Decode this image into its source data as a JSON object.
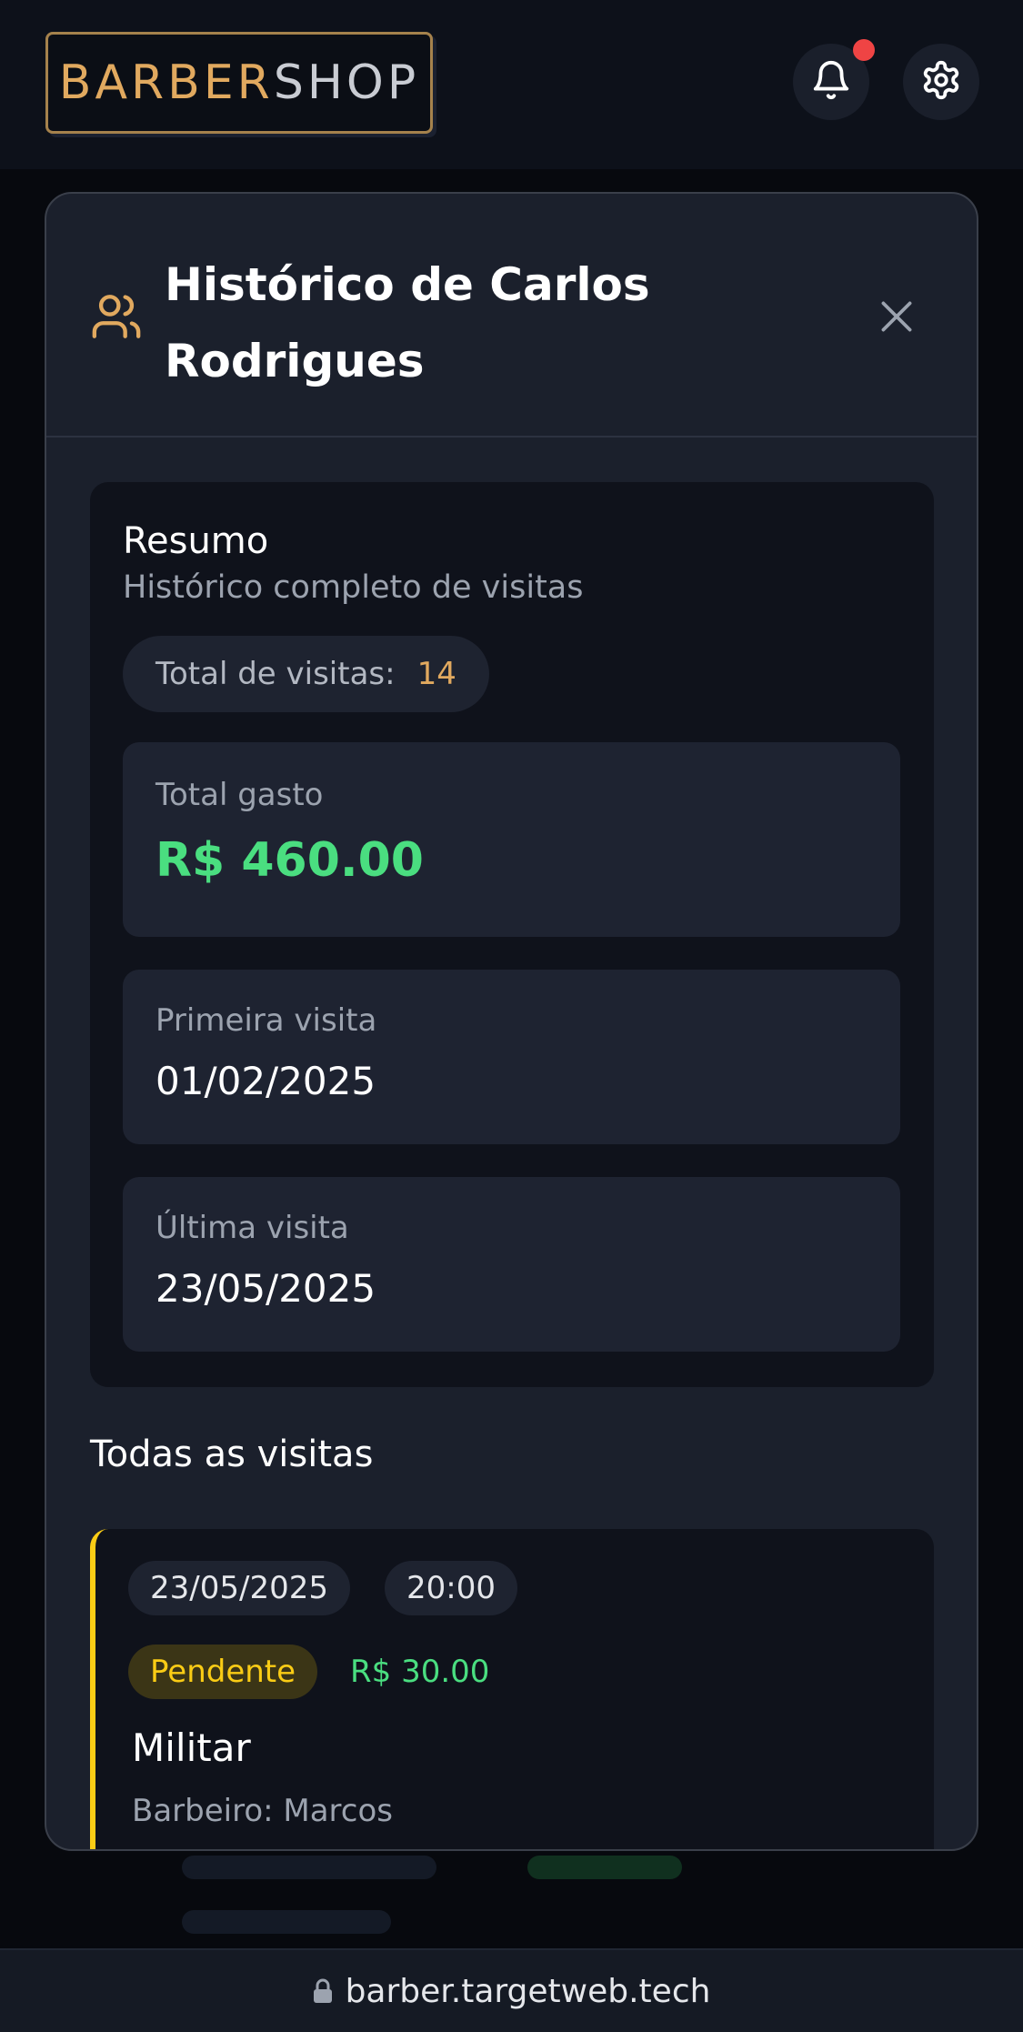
{
  "header": {
    "logo_primary": "BARBER",
    "logo_secondary": "SHOP",
    "notification_icon": "bell-icon",
    "settings_icon": "gear-icon"
  },
  "modal": {
    "title": "Histórico de Carlos Rodrigues",
    "title_icon": "users-icon",
    "close_icon": "close-icon",
    "summary": {
      "title": "Resumo",
      "subtitle": "Histórico completo de visitas",
      "total_visits_label": "Total de visitas:",
      "total_visits_value": "14",
      "total_spent_label": "Total gasto",
      "total_spent_value": "R$ 460.00",
      "first_visit_label": "Primeira visita",
      "first_visit_value": "01/02/2025",
      "last_visit_label": "Última visita",
      "last_visit_value": "23/05/2025"
    },
    "visits_section_title": "Todas as visitas",
    "visits": [
      {
        "date": "23/05/2025",
        "time": "20:00",
        "status": "Pendente",
        "price": "R$ 30.00",
        "service": "Militar",
        "barber": "Barbeiro: Marcos"
      }
    ]
  },
  "urlbar": {
    "url": "barber.targetweb.tech",
    "lock_icon": "lock-icon"
  },
  "colors": {
    "accent_gold": "#e1a95f",
    "money_green": "#4ade80",
    "pending_yellow": "#facc15",
    "notification_red": "#ef4444"
  }
}
